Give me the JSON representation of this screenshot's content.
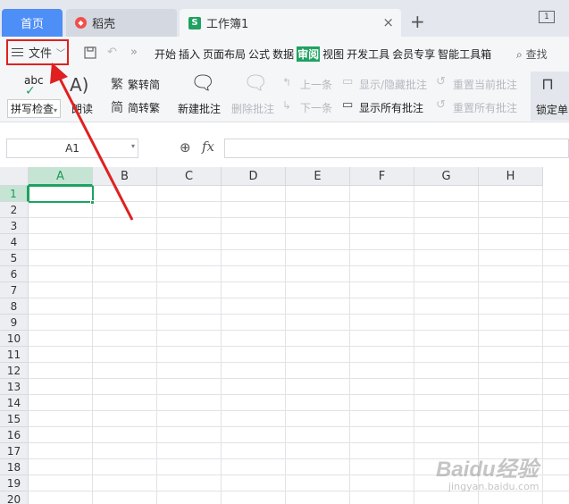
{
  "tabs": {
    "home": "首页",
    "docer": "稻壳",
    "workbook": "工作簿1",
    "close": "×",
    "add": "+",
    "window_count": "1"
  },
  "menubar": {
    "file": "文件",
    "items": [
      "开始",
      "插入",
      "页面布局",
      "公式",
      "数据",
      "审阅",
      "视图",
      "开发工具",
      "会员专享",
      "智能工具箱"
    ],
    "active_item": "审阅",
    "search": "查找"
  },
  "ribbon": {
    "spellcheck": "拼写检查",
    "read_aloud": "朗读",
    "trad_to_simp": "繁转简",
    "simp_to_trad": "简转繁",
    "new_comment": "新建批注",
    "delete_comment": "删除批注",
    "prev": "上一条",
    "next": "下一条",
    "show_hide_comment": "显示/隐藏批注",
    "show_all_comments": "显示所有批注",
    "reset_current": "重置当前批注",
    "reset_all": "重置所有批注",
    "lock_cell": "锁定单",
    "abc": "abc"
  },
  "formula_bar": {
    "name_box": "A1",
    "fx": "fx",
    "value": ""
  },
  "sheet": {
    "columns": [
      "A",
      "B",
      "C",
      "D",
      "E",
      "F",
      "G",
      "H"
    ],
    "rows": [
      "1",
      "2",
      "3",
      "4",
      "5",
      "6",
      "7",
      "8",
      "9",
      "10",
      "11",
      "12",
      "13",
      "14",
      "15",
      "16",
      "17",
      "18",
      "19",
      "20"
    ],
    "selected_cell": "A1"
  },
  "watermark": {
    "main": "Baidu经验",
    "sub": "jingyan.baidu.com"
  },
  "colors": {
    "accent_green": "#1fa260",
    "home_tab_blue": "#4e8ef7",
    "annotation_red": "#e02020"
  }
}
